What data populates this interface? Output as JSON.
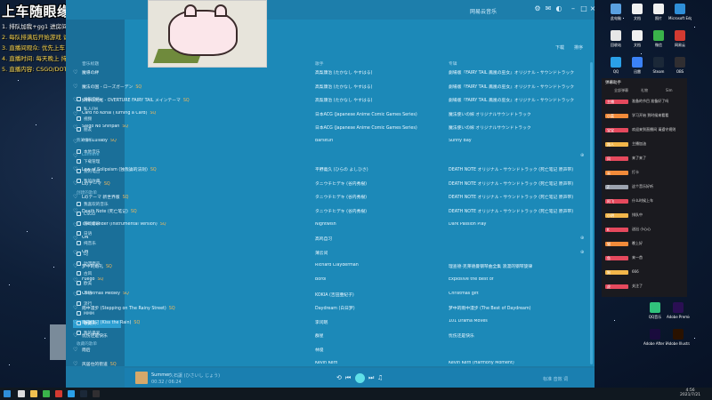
{
  "overlay": {
    "title": "上车随眼缘，熟人优先",
    "lines": [
      "1. 排队加我+gg1 进房间",
      "2. 每队排满后开始游戏 请勿插队",
      "3. 直播间观众: 优先上车 不定时抽奖",
      "4. 直播时间: 每天晚上 持续到凌晨",
      "5. 直播内容: CSGO/DOTA2/APEX 等游戏"
    ]
  },
  "music": {
    "window_title": "网易云音乐",
    "tab_pill": "全部",
    "actions": [
      "下载",
      "排序"
    ],
    "columns": {
      "title": "音乐标题",
      "artist": "歌手",
      "album": "专辑"
    },
    "sidebar": [
      {
        "label": "发现音乐",
        "active": false
      },
      {
        "label": "私人FM",
        "active": false
      },
      {
        "label": "视频",
        "active": false
      },
      {
        "label": "朋友",
        "active": false
      },
      {
        "label": "我的音乐",
        "section": true
      },
      {
        "label": "本地音乐",
        "active": false
      },
      {
        "label": "下载管理",
        "active": false
      },
      {
        "label": "我的电台",
        "active": false
      },
      {
        "label": "我的收藏",
        "active": false
      },
      {
        "label": "创建的歌单",
        "section": true
      },
      {
        "label": "我喜欢的音乐",
        "active": false
      },
      {
        "label": "CSGO",
        "active": false
      },
      {
        "label": "游戏音乐",
        "active": false
      },
      {
        "label": "日语",
        "active": false
      },
      {
        "label": "纯音乐",
        "active": false
      },
      {
        "label": "DJ",
        "active": false
      },
      {
        "label": "动漫原声",
        "active": false
      },
      {
        "label": "古风",
        "active": false
      },
      {
        "label": "欧美",
        "active": false
      },
      {
        "label": "华语",
        "active": false
      },
      {
        "label": "流行",
        "active": false
      },
      {
        "label": "MMM",
        "active": false
      },
      {
        "label": "收藏夹",
        "active": true
      },
      {
        "label": "我的最爱",
        "active": false
      },
      {
        "label": "收藏的歌单",
        "section": true
      }
    ],
    "tracks": [
      {
        "title": "魔導の絆",
        "tag": "",
        "artist": "高梨康治 (たかなし やすはる)",
        "album": "劇場版『FAIRY TAIL 鳳凰の巫女』オリジナル・サウンドトラック",
        "faded": false
      },
      {
        "title": "魔法の国 - ローズガーデン",
        "tag": "SQ",
        "artist": "高梨康治 (たかなし やすはる)",
        "album": "劇場版『FAIRY TAIL 鳳凰の巫女』オリジナル・サウンドトラック",
        "faded": false
      },
      {
        "title": "妖精の尻尾 - OVERTURE FAIRY TAIL メインテーマ",
        "tag": "SQ",
        "artist": "高梨康治 (たかなし やすはる)",
        "album": "劇場版『FAIRY TAIL 鳳凰の巫女』オリジナル・サウンドトラック",
        "faded": false
      },
      {
        "title": "Card no Kohai (Turning a Card)",
        "tag": "SQ",
        "artist": "日本ACG (Japanese Anime Comic Games Series)",
        "album": "魔法使いの嫁 オリジナルサウンドトラック",
        "faded": false
      },
      {
        "title": "Saigo No Shinpan",
        "tag": "SQ",
        "artist": "日本ACG (Japanese Anime Comic Games Series)",
        "album": "魔法使いの嫁 オリジナルサウンドトラック",
        "faded": false
      },
      {
        "title": "Irish Lullaby",
        "tag": "SQ",
        "artist": "Barsituri",
        "album": "Sunny Bay",
        "faded": false
      },
      {
        "title": "Lumiere",
        "tag": "",
        "artist": "",
        "album": "",
        "faded": true
      },
      {
        "title": "Low of Solipsism (独我論的法則)",
        "tag": "SQ",
        "artist": "平野義久 (ひらの よしひさ)",
        "album": "DEATH NOTE オリジナル・サウンドトラック (死亡笔记 原声带)",
        "faded": false
      },
      {
        "title": "Lのテーマ",
        "tag": "SQ",
        "artist": "タニウチヒデキ (谷内秀樹)",
        "album": "DEATH NOTE オリジナル・サウンドトラック (死亡笔记 原声带)",
        "faded": false
      },
      {
        "title": "Lのテーマ 新世界版",
        "tag": "SQ",
        "artist": "タニウチヒデキ (谷内秀樹)",
        "album": "DEATH NOTE オリジナル・サウンドトラック (死亡笔记 原声带)",
        "faded": false
      },
      {
        "title": "Death Note (死亡笔记)",
        "tag": "SQ",
        "artist": "タニウチヒデキ (谷内秀樹)",
        "album": "DEATH NOTE オリジナル・サウンドトラック (死亡笔记 原声带)",
        "faded": false
      },
      {
        "title": "The Islander (Instrumental Version)",
        "tag": "SQ",
        "artist": "Nightwish",
        "album": "Dark Passion Play",
        "faded": false
      },
      {
        "title": "ON",
        "tag": "",
        "artist": "高鸣自习",
        "album": "",
        "faded": false
      },
      {
        "title": "ON",
        "tag": "",
        "artist": "薄云间",
        "album": "",
        "faded": false
      },
      {
        "title": "梦中的婚礼",
        "tag": "SQ",
        "artist": "Richard Clayderman",
        "album": "理查德·克莱德曼钢琴曲全集 浪漫的钢琴旋律",
        "faded": false
      },
      {
        "title": "Fuego",
        "tag": "SQ",
        "artist": "Borol",
        "album": "Explosive the Best of",
        "faded": false
      },
      {
        "title": "Christmas Medley",
        "tag": "SQ",
        "artist": "KOKIA (吉田亜紀子)",
        "album": "Christmas gift",
        "faded": false
      },
      {
        "title": "雨中漫步 (Stepping on The Rainy Street)",
        "tag": "SQ",
        "artist": "Daydream (白日梦)",
        "album": "梦中的雨中漫步 (The Best of Daydream)",
        "faded": false
      },
      {
        "title": "雨的印记 (Kiss the Rain)",
        "tag": "SQ",
        "artist": "李闰珉",
        "album": "101 Drama Moves",
        "faded": false
      },
      {
        "title": "忧伤还是快乐",
        "tag": "",
        "artist": "群星",
        "album": "忧伤还是快乐",
        "faded": false
      },
      {
        "title": "雨后",
        "tag": "",
        "artist": "林俊",
        "album": "",
        "faded": false
      },
      {
        "title": "风居住的街道",
        "tag": "SQ",
        "artist": "Kevin Kern",
        "album": "Kevin Kern (Harmony Moment)",
        "faded": false
      }
    ],
    "player": {
      "track": "Summer",
      "artist": "久石譲 (ひさいし じょう)",
      "time": "00:32 / 06:24",
      "extras": "标准 音效 词"
    }
  },
  "chat": {
    "title": "弹幕助手",
    "tabs": [
      "全部弹幕",
      "礼物",
      "Sim"
    ],
    "lines": [
      {
        "name": "主播",
        "text": "准备的节目 准备好了吗",
        "color": "#e5495d"
      },
      {
        "name": "小菜",
        "text": "学习开始 到时候来看看",
        "color": "#f28b3a"
      },
      {
        "name": "宝宝",
        "text": "欢迎来到直播间 请遵守规则",
        "color": "#e5495d"
      },
      {
        "name": "路人",
        "text": "主播加油",
        "color": "#f2b64a"
      },
      {
        "name": "风",
        "text": "来了来了",
        "color": "#e5495d"
      },
      {
        "name": "云",
        "text": "打卡",
        "color": "#f28b3a"
      },
      {
        "name": "Z",
        "text": "这个音乐好听",
        "color": "#9ca3af"
      },
      {
        "name": "阿飞",
        "text": "什么时候上车",
        "color": "#e5495d"
      },
      {
        "name": "小明",
        "text": "排队中",
        "color": "#f2b64a"
      },
      {
        "name": "K",
        "text": "送出 小心心",
        "color": "#e5495d"
      },
      {
        "name": "猫",
        "text": "晚上好",
        "color": "#f28b3a"
      },
      {
        "name": "鱼",
        "text": "来一首",
        "color": "#e5495d"
      },
      {
        "name": "狗",
        "text": "666",
        "color": "#f2b64a"
      },
      {
        "name": "虎",
        "text": "关注了",
        "color": "#e5495d"
      }
    ]
  },
  "desktop": {
    "icons": [
      {
        "label": "此电脑",
        "color": "#5aa0e0"
      },
      {
        "label": "文档",
        "color": "#f0f0f0"
      },
      {
        "label": "照片",
        "color": "#f0f0f0"
      },
      {
        "label": "Microsoft Edge",
        "color": "#2f8fd8"
      },
      {
        "label": "回收站",
        "color": "#e7e7e7"
      },
      {
        "label": "文档",
        "color": "#f0f0f0"
      },
      {
        "label": "微信",
        "color": "#3ab34a"
      },
      {
        "label": "网易云",
        "color": "#d33a31"
      },
      {
        "label": "QQ",
        "color": "#2aa0e8"
      },
      {
        "label": "迅雷",
        "color": "#3b82f6"
      },
      {
        "label": "Steam",
        "color": "#1b2838"
      },
      {
        "label": "OBS",
        "color": "#302e31"
      },
      {
        "label": "QQ音乐",
        "color": "#31c27c"
      },
      {
        "label": "Adobe Premie",
        "color": "#2a0f53"
      },
      {
        "label": "Adobe After Effects 2020",
        "color": "#1a0b3d"
      },
      {
        "label": "Adobe Illustrator",
        "color": "#2a1200"
      }
    ]
  },
  "taskbar": {
    "time": "4:56",
    "date": "2021/7/21"
  }
}
